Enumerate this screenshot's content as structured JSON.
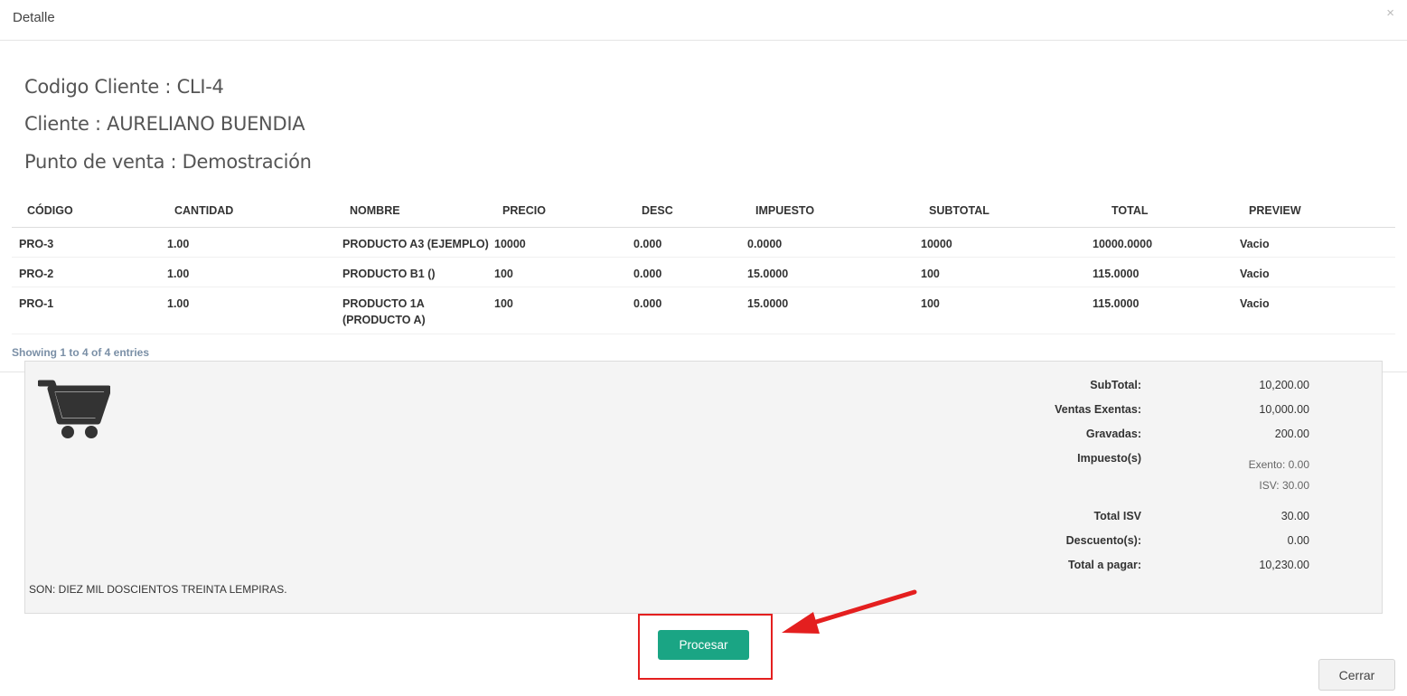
{
  "modal": {
    "title": "Detalle",
    "close_symbol": "×"
  },
  "info": {
    "codigo_cliente": "Codigo Cliente : CLI-4",
    "cliente": "Cliente : AURELIANO BUENDIA",
    "punto_venta": "Punto de venta : Demostración"
  },
  "table": {
    "headers": [
      "CÓDIGO",
      "CANTIDAD",
      "NOMBRE",
      "PRECIO",
      "DESC",
      "IMPUESTO",
      "SUBTOTAL",
      "TOTAL",
      "PREVIEW"
    ],
    "rows": [
      [
        "PRO-3",
        "1.00",
        "PRODUCTO A3 (EJEMPLO)",
        "10000",
        "0.000",
        "0.0000",
        "10000",
        "10000.0000",
        "Vacio"
      ],
      [
        "PRO-2",
        "1.00",
        "PRODUCTO B1 ()",
        "100",
        "0.000",
        "15.0000",
        "100",
        "115.0000",
        "Vacio"
      ],
      [
        "PRO-1",
        "1.00",
        "PRODUCTO 1A (PRODUCTO A)",
        "100",
        "0.000",
        "15.0000",
        "100",
        "115.0000",
        "Vacio"
      ]
    ],
    "entries_info": "Showing 1 to 4 of 4 entries"
  },
  "summary": {
    "subtotal_label": "SubTotal:",
    "subtotal_value": "10,200.00",
    "exentas_label": "Ventas Exentas:",
    "exentas_value": "10,000.00",
    "gravadas_label": "Gravadas:",
    "gravadas_value": "200.00",
    "impuestos_label": "Impuesto(s)",
    "exento_line": "Exento: 0.00",
    "isv_line": "ISV: 30.00",
    "total_isv_label": "Total ISV",
    "total_isv_value": "30.00",
    "descuento_label": "Descuento(s):",
    "descuento_value": "0.00",
    "total_pagar_label": "Total a pagar:",
    "total_pagar_value": "10,230.00",
    "son_text": "SON: DIEZ MIL DOSCIENTOS TREINTA LEMPIRAS."
  },
  "actions": {
    "procesar_label": "Procesar",
    "cerrar_label": "Cerrar"
  },
  "colors": {
    "primary_button": "#1aa584",
    "annotation_red": "#e41f1f",
    "panel_bg": "#f4f4f4"
  },
  "icons": {
    "cart": "shopping-cart-icon",
    "close": "close-icon",
    "arrow": "annotation-arrow-icon"
  }
}
